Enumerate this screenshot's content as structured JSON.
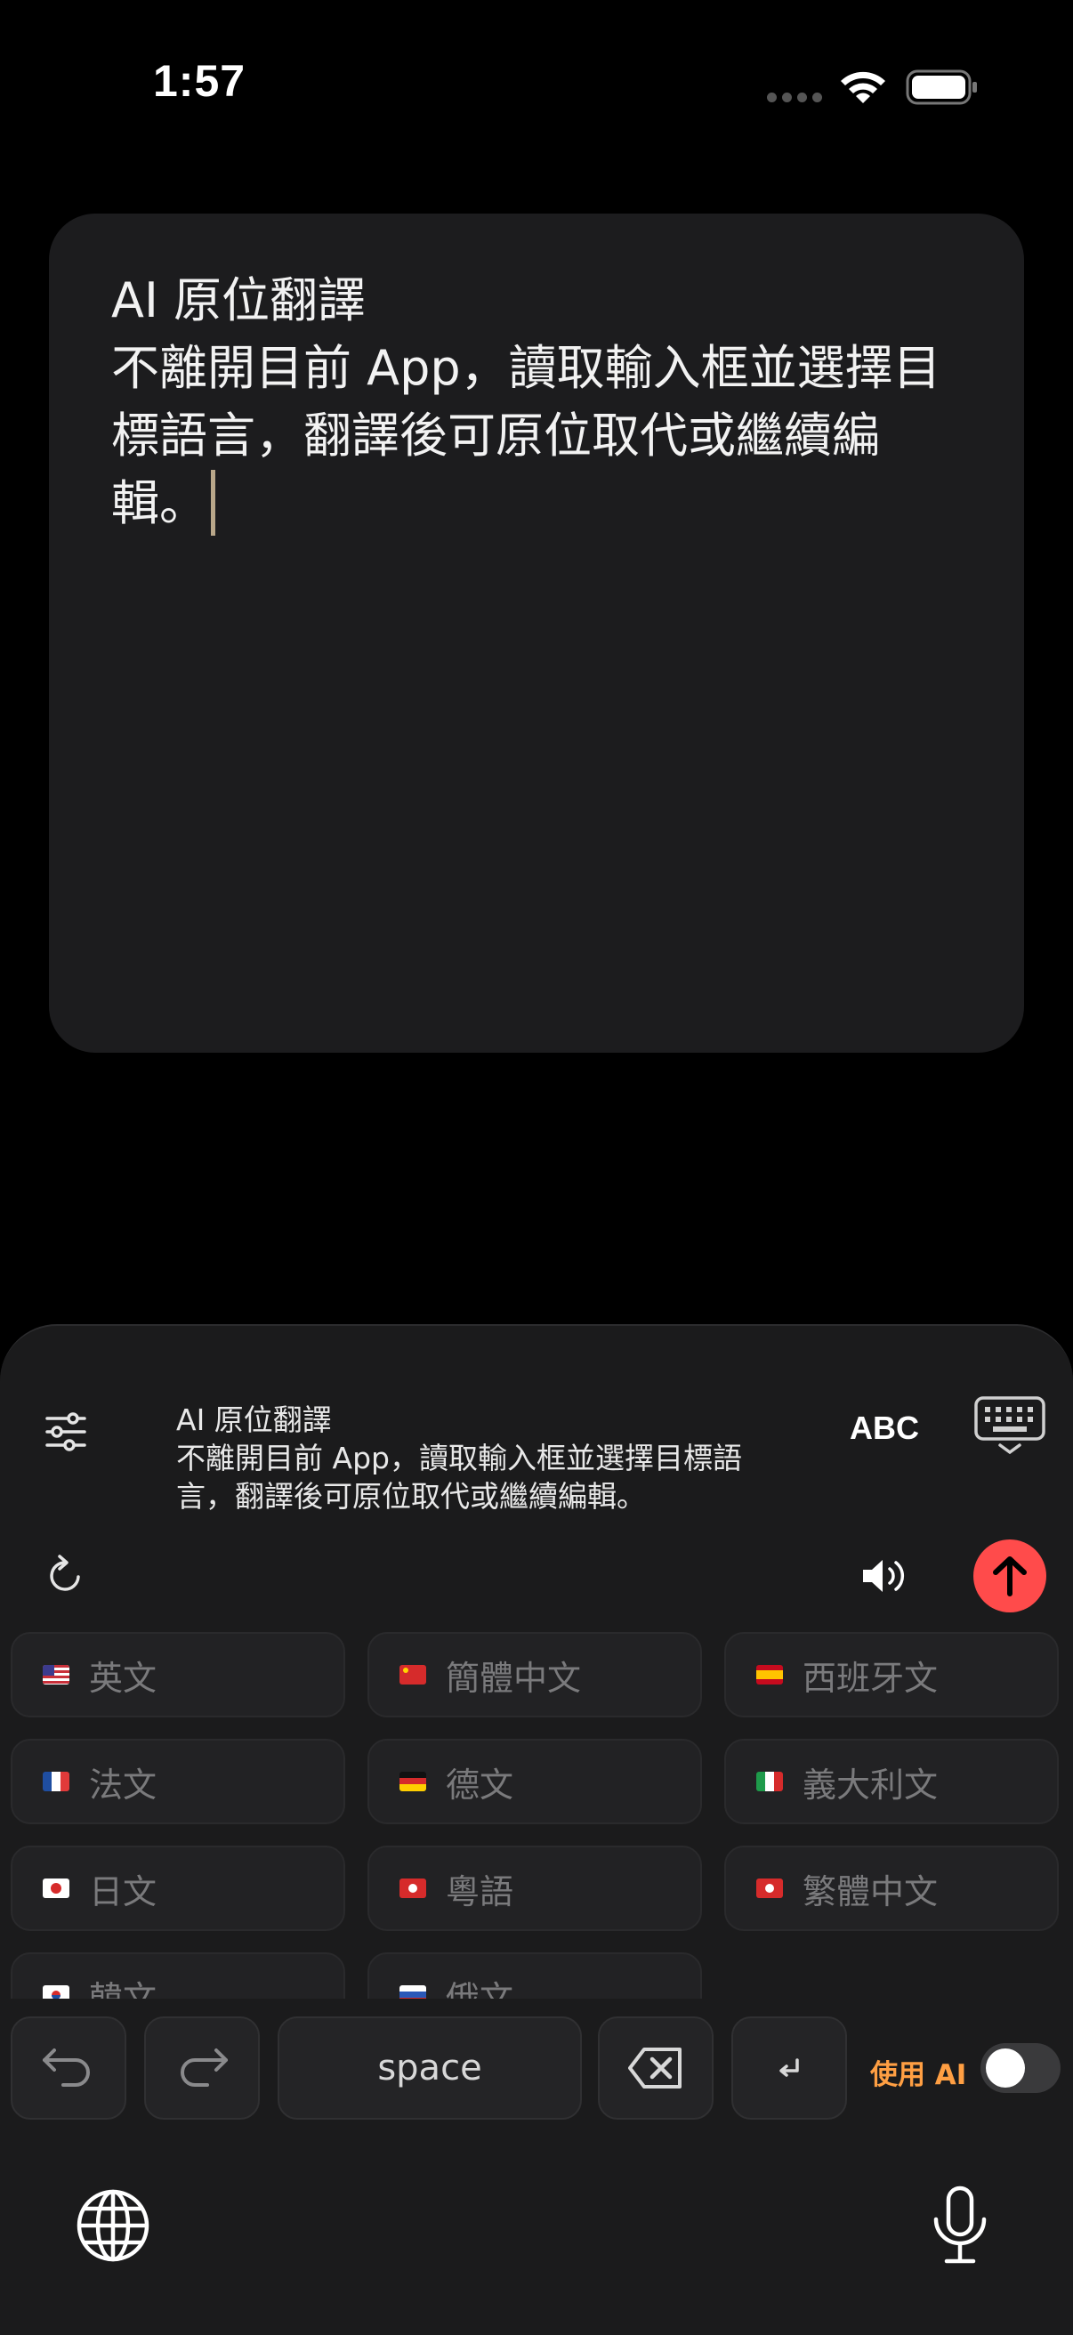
{
  "status_bar": {
    "time": "1:57"
  },
  "editor": {
    "text": "AI 原位翻譯\n不離開目前 App，讀取輸入框並選擇目標語言，翻譯後可原位取代或繼續編輯。"
  },
  "keyboard": {
    "preview_text": "AI 原位翻譯\n不離開目前 App，讀取輸入框並選擇目標語\n言，翻譯後可原位取代或繼續編輯。",
    "abc_label": "ABC",
    "languages": [
      {
        "label": "英文",
        "flag": "us"
      },
      {
        "label": "簡體中文",
        "flag": "cn"
      },
      {
        "label": "西班牙文",
        "flag": "es"
      },
      {
        "label": "法文",
        "flag": "fr"
      },
      {
        "label": "德文",
        "flag": "de"
      },
      {
        "label": "義大利文",
        "flag": "it"
      },
      {
        "label": "日文",
        "flag": "jp"
      },
      {
        "label": "粵語",
        "flag": "hk"
      },
      {
        "label": "繁體中文",
        "flag": "hk"
      },
      {
        "label": "韓文",
        "flag": "kr"
      },
      {
        "label": "俄文",
        "flag": "ru"
      }
    ],
    "space_label": "space",
    "ai_toggle_label": "使用 AI",
    "ai_toggle_on": false,
    "accent_color": "#ff4b4b",
    "ai_label_color": "#ff9f43"
  }
}
